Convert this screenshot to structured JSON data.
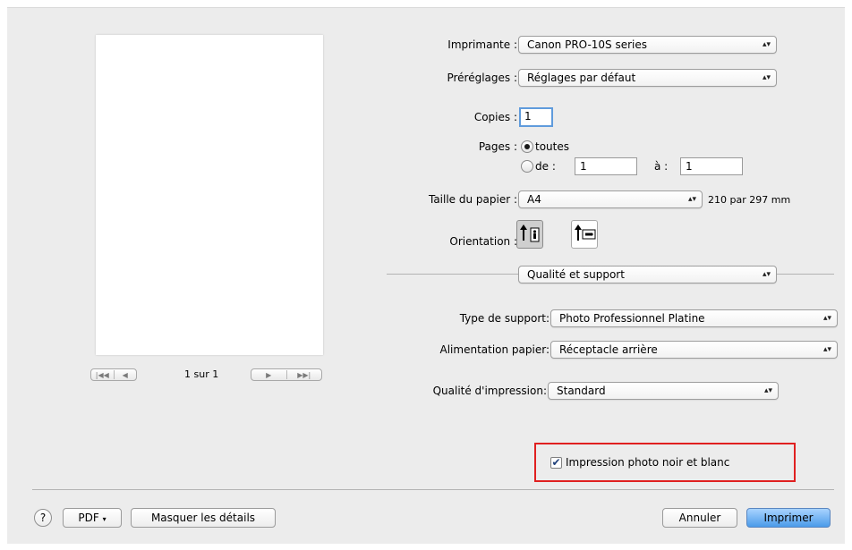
{
  "preview": {
    "first_icon": "first-page-icon",
    "prev_icon": "previous-page-icon",
    "next_icon": "next-page-icon",
    "last_icon": "last-page-icon",
    "pager_text": "1 sur 1"
  },
  "printer": {
    "label": "Imprimante :",
    "value": "Canon PRO-10S series"
  },
  "presets": {
    "label": "Préréglages :",
    "value": "Réglages par défaut"
  },
  "copies": {
    "label": "Copies :",
    "value": "1"
  },
  "pages": {
    "label": "Pages :",
    "all_label": "toutes",
    "from_label": "de :",
    "from_value": "1",
    "to_label": "à :",
    "to_value": "1"
  },
  "paper_size": {
    "label": "Taille du papier :",
    "value": "A4",
    "dimensions": "210 par 297 mm"
  },
  "orientation": {
    "label": "Orientation :",
    "portrait_icon": "portrait-orientation-icon",
    "landscape_icon": "landscape-orientation-icon"
  },
  "section": {
    "value": "Qualité et support"
  },
  "media_type": {
    "label": "Type de support:",
    "value": "Photo Professionnel Platine"
  },
  "paper_source": {
    "label": "Alimentation papier:",
    "value": "Réceptacle arrière"
  },
  "print_quality": {
    "label": "Qualité d'impression:",
    "value": "Standard"
  },
  "bw_photo": {
    "label": "Impression photo noir et blanc",
    "checked": true
  },
  "footer": {
    "help_label": "?",
    "pdf_label": "PDF",
    "hide_details_label": "Masquer les détails",
    "cancel_label": "Annuler",
    "print_label": "Imprimer"
  },
  "colors": {
    "highlight": "#e02020",
    "primary_button": "#4b9be9",
    "focus_ring": "#5f9bdc"
  }
}
